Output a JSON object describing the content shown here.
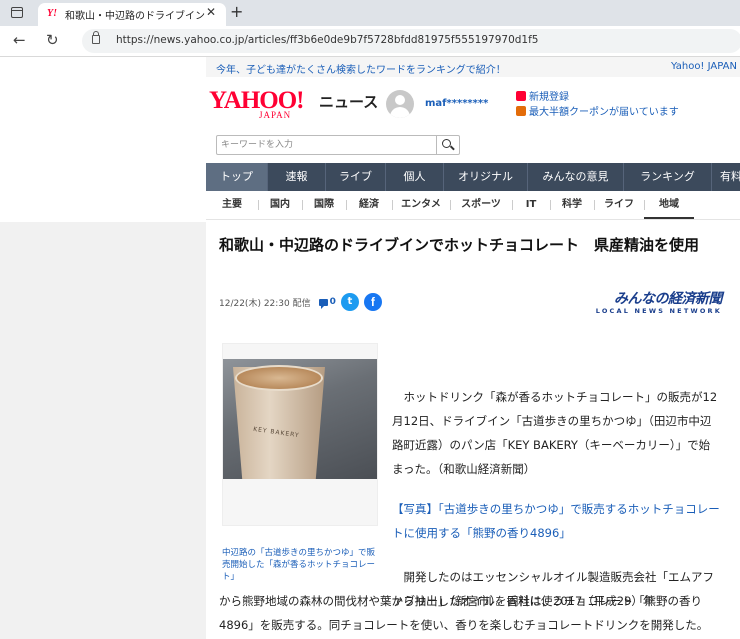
{
  "browser": {
    "tab_title": "和歌山・中辺路のドライブインでホット",
    "tab_favicon": "Y!",
    "url": "https://news.yahoo.co.jp/articles/ff3b6e0de9b7f5728bfdd81975f555197970d1f5"
  },
  "announcement": {
    "text": "今年、子ども達がたくさん検索したワードをランキングで紹介！",
    "right": "Yahoo! JAPAN"
  },
  "header": {
    "logo_main": "YAHOO!",
    "logo_sub": "JAPAN",
    "logo_news": "ニュース",
    "username": "maf********",
    "links": [
      {
        "label": "新規登録",
        "icon_color": "#ff0033"
      },
      {
        "label": "最大半額クーポンが届いています",
        "icon_color": "#e36c09"
      }
    ]
  },
  "search": {
    "placeholder": "キーワードを入力"
  },
  "topnav": [
    "トップ",
    "速報",
    "ライブ",
    "個人",
    "オリジナル",
    "みんなの意見",
    "ランキング",
    "有料"
  ],
  "subnav": [
    "主要",
    "国内",
    "国際",
    "経済",
    "エンタメ",
    "スポーツ",
    "IT",
    "科学",
    "ライフ",
    "地域"
  ],
  "article": {
    "title": "和歌山・中辺路のドライブインでホットチョコレート　県産精油を使用",
    "date": "12/22(木) 22:30 配信",
    "comment_count": "0",
    "source_main": "みんなの経済新聞",
    "source_sub": "LOCAL NEWS NETWORK",
    "photo_cup_text": "KEY BAKERY",
    "photo_caption": "中辺路の「古道歩きの里ちかつゆ」で販売開始した「森が香るホットチョコレート」",
    "para1": "ホットドリンク「森が香るホットチョコレート」の販売が12月12日、ドライブイン「古道歩きの里ちかつゆ」（田辺市中辺路町近露）のパン店「KEY BAKERY（キーベーカリー）」で始まった。（和歌山経済新聞）",
    "link_text": "【写真】「古道歩きの里ちかつゆ」で販売するホットチョコレートに使用する「熊野の香り4896」",
    "para2": "開発したのはエッセンシャルオイル製造販売会社「エムアファブリー」（新宮市）。同社は、2017（平成29）年",
    "para3": "から熊野地域の森林の間伐材や葉から抽出したオイルを香料に使うチョコレート「熊野の香り4896」を販売する。同チョコレートを使い、香りを楽しむチョコレートドリンクを開発した。"
  }
}
